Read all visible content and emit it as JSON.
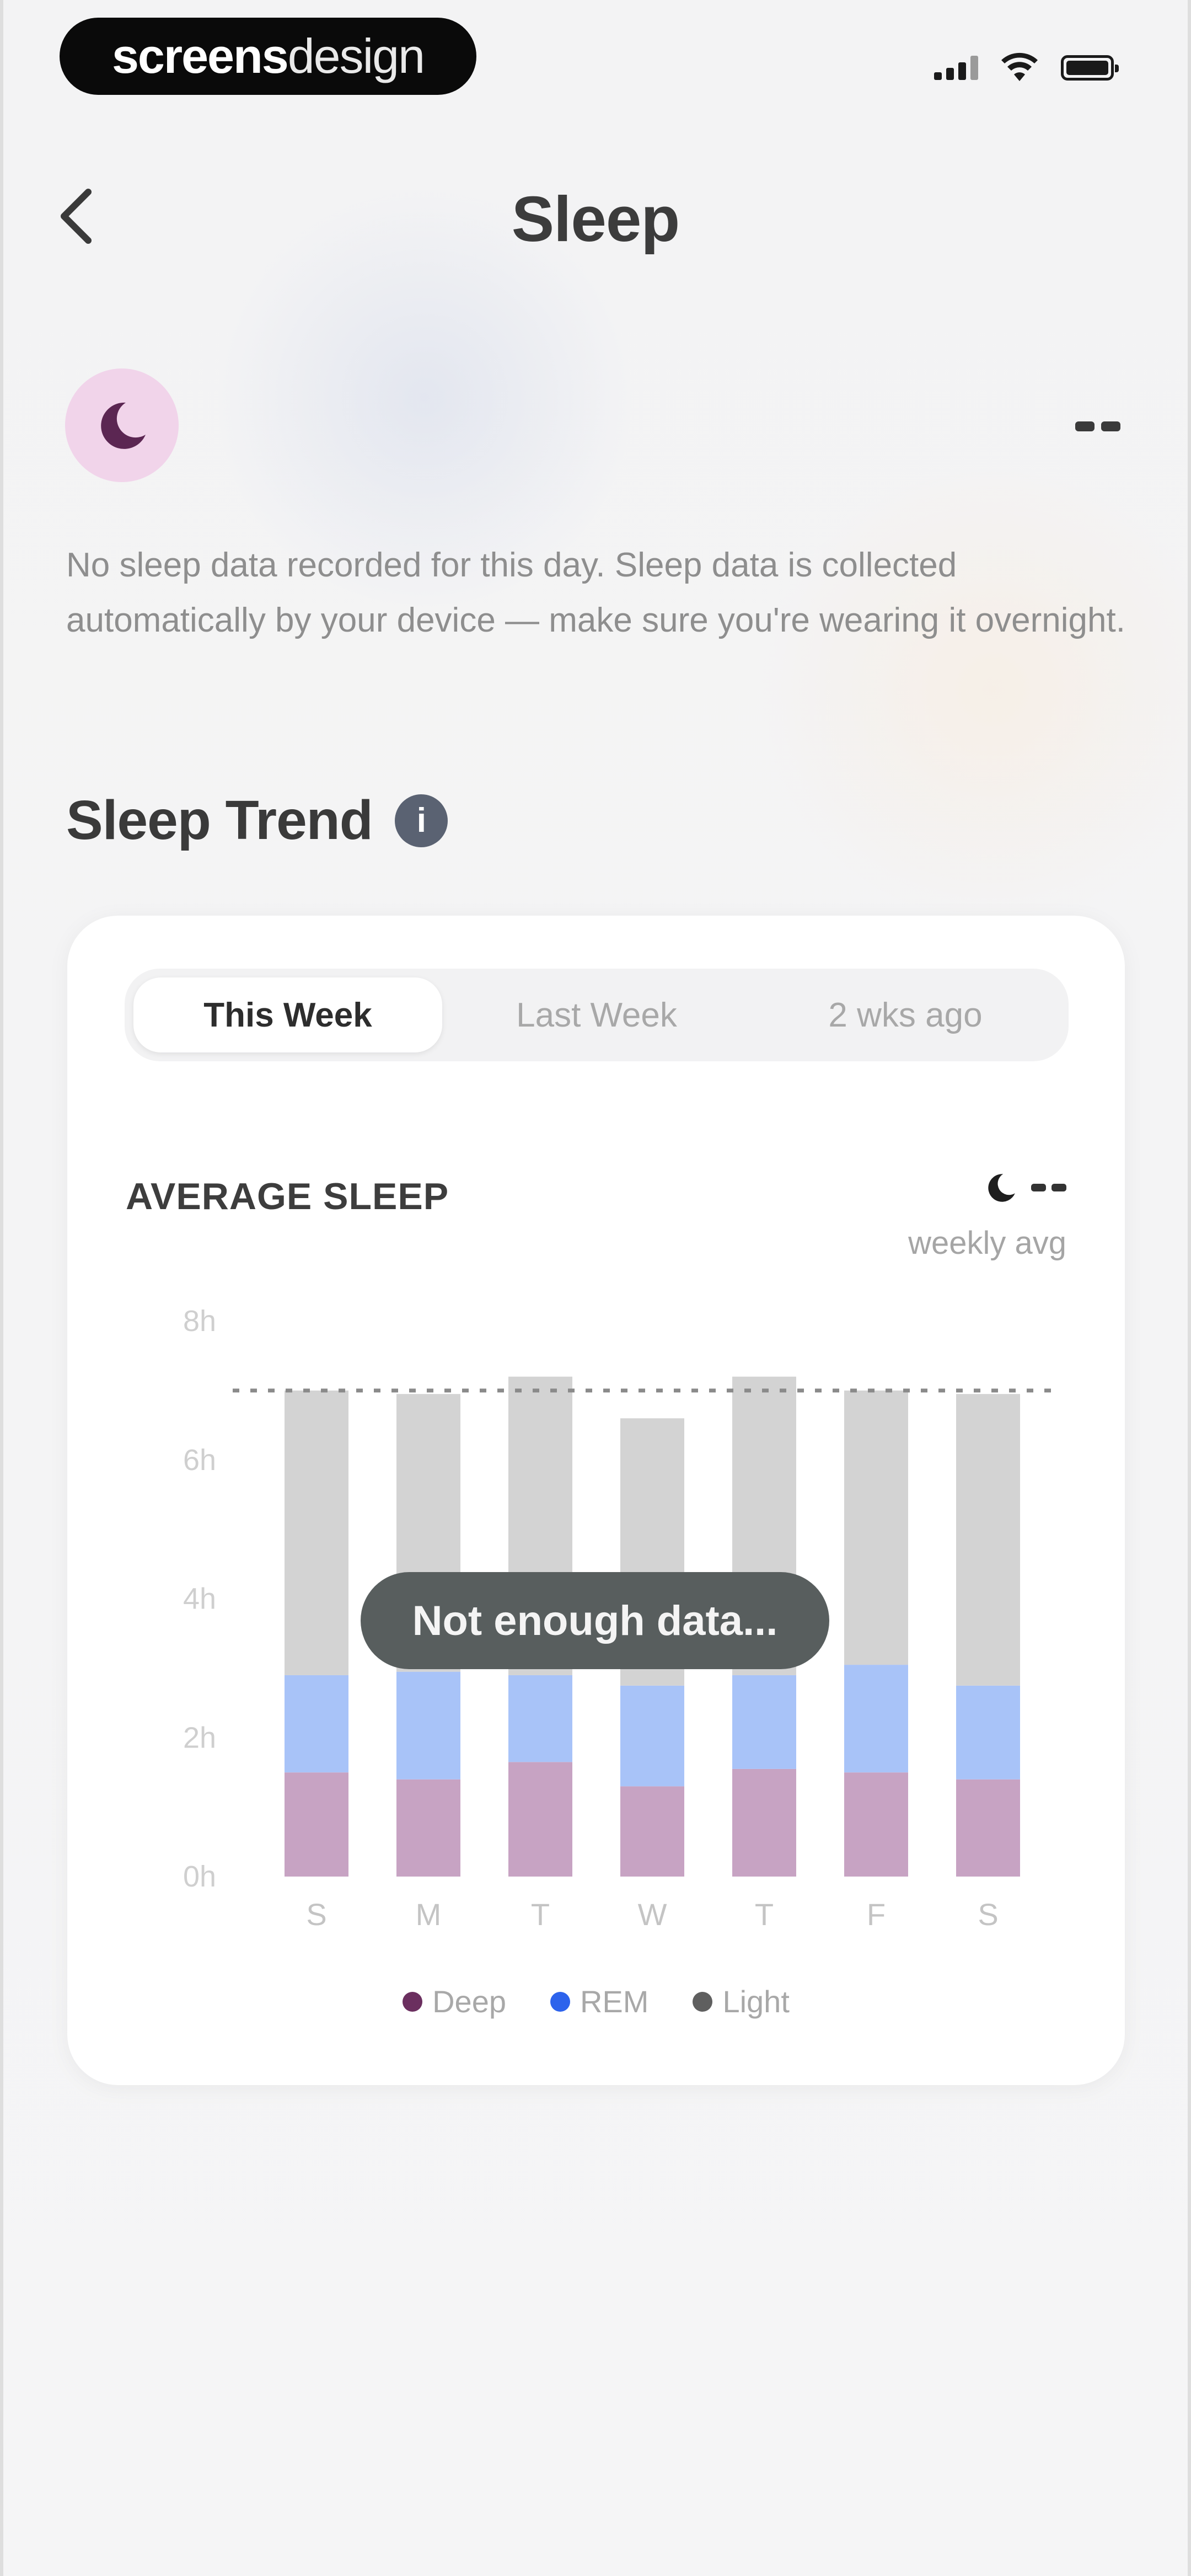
{
  "status_bar": {
    "brand_bold": "screens",
    "brand_light": "design",
    "icons": [
      "signal-icon",
      "wifi-icon",
      "battery-icon"
    ]
  },
  "header": {
    "back_icon": "chevron-left-icon",
    "title": "Sleep"
  },
  "summary": {
    "avatar_icon": "moon-icon",
    "value_placeholder": "--",
    "message": "No sleep data recorded for this day. Sleep data is collected automatically by your device — make sure you're wearing it overnight."
  },
  "trend": {
    "title": "Sleep Trend",
    "info_icon_label": "i",
    "tabs": [
      {
        "label": "This Week",
        "active": true
      },
      {
        "label": "Last Week",
        "active": false
      },
      {
        "label": "2 wks ago",
        "active": false
      }
    ],
    "average_label": "AVERAGE SLEEP",
    "average_value": "--",
    "average_sub": "weekly avg",
    "overlay_message": "Not enough data..."
  },
  "chart_data": {
    "type": "bar",
    "stacked": true,
    "categories": [
      "S",
      "M",
      "T",
      "W",
      "T",
      "F",
      "S"
    ],
    "y_ticks": [
      "8h",
      "6h",
      "4h",
      "2h",
      "0h"
    ],
    "ylim": [
      0,
      8
    ],
    "reference_line": 7.0,
    "series": [
      {
        "name": "Deep",
        "color": "#c7a3c3",
        "values": [
          1.5,
          1.4,
          1.65,
          1.3,
          1.55,
          1.5,
          1.4
        ]
      },
      {
        "name": "REM",
        "color": "#a8c3f8",
        "values": [
          1.4,
          1.55,
          1.25,
          1.45,
          1.35,
          1.55,
          1.35
        ]
      },
      {
        "name": "Light",
        "color": "#d3d3d3",
        "values": [
          4.1,
          4.0,
          4.3,
          3.85,
          4.3,
          3.95,
          4.2
        ]
      }
    ],
    "legend": [
      {
        "name": "Deep",
        "color": "#6b2f5f"
      },
      {
        "name": "REM",
        "color": "#2d63ec"
      },
      {
        "name": "Light",
        "color": "#5f5f5f"
      }
    ]
  }
}
